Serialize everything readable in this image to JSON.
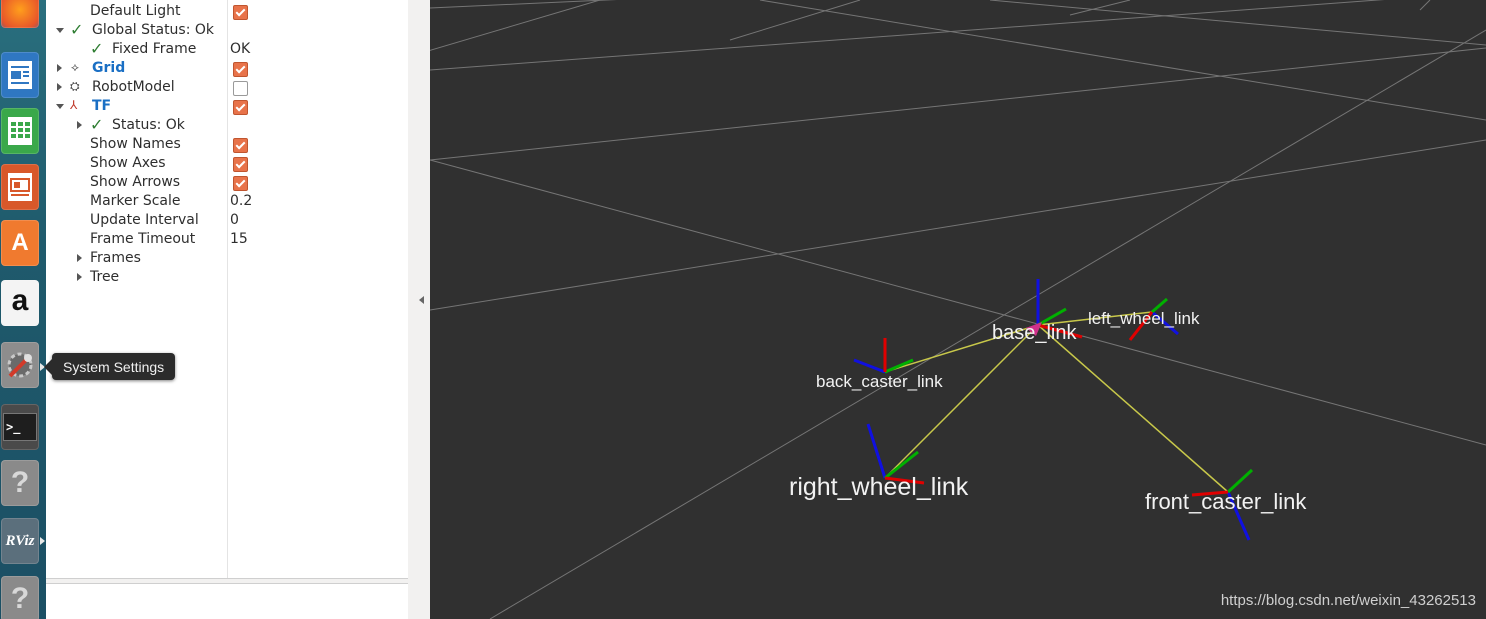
{
  "launcher": {
    "items": [
      {
        "name": "firefox-icon",
        "glyph": ""
      },
      {
        "name": "writer-icon",
        "glyph": ""
      },
      {
        "name": "calc-icon",
        "glyph": ""
      },
      {
        "name": "impress-icon",
        "glyph": ""
      },
      {
        "name": "software-center-icon",
        "glyph": "A"
      },
      {
        "name": "amazon-icon",
        "glyph": "a"
      },
      {
        "name": "system-settings-icon",
        "glyph": ""
      },
      {
        "name": "terminal-icon",
        "glyph": ">_"
      },
      {
        "name": "unknown-app-icon",
        "glyph": "?"
      },
      {
        "name": "rviz-icon",
        "glyph": "RViz"
      },
      {
        "name": "unknown-app-icon-2",
        "glyph": "?"
      }
    ],
    "tooltip": "System Settings"
  },
  "displays": {
    "rows": [
      {
        "label": "Default Light",
        "value": "",
        "checkbox": "on"
      },
      {
        "label": "Global Status: Ok",
        "value": "",
        "checkbox": ""
      },
      {
        "label": "Fixed Frame",
        "value": "OK",
        "checkbox": ""
      },
      {
        "label": "Grid",
        "value": "",
        "checkbox": "on"
      },
      {
        "label": "RobotModel",
        "value": "",
        "checkbox": "off"
      },
      {
        "label": "TF",
        "value": "",
        "checkbox": "on"
      },
      {
        "label": "Status: Ok",
        "value": "",
        "checkbox": ""
      },
      {
        "label": "Show Names",
        "value": "",
        "checkbox": "on"
      },
      {
        "label": "Show Axes",
        "value": "",
        "checkbox": "on"
      },
      {
        "label": "Show Arrows",
        "value": "",
        "checkbox": "on"
      },
      {
        "label": "Marker Scale",
        "value": "0.2",
        "checkbox": ""
      },
      {
        "label": "Update Interval",
        "value": "0",
        "checkbox": ""
      },
      {
        "label": "Frame Timeout",
        "value": "15",
        "checkbox": ""
      },
      {
        "label": "Frames",
        "value": "",
        "checkbox": ""
      },
      {
        "label": "Tree",
        "value": "",
        "checkbox": ""
      }
    ]
  },
  "view": {
    "frames": [
      {
        "name": "base_link"
      },
      {
        "name": "left_wheel_link"
      },
      {
        "name": "back_caster_link"
      },
      {
        "name": "right_wheel_link"
      },
      {
        "name": "front_caster_link"
      }
    ],
    "watermark": "https://blog.csdn.net/weixin_43262513"
  },
  "colors": {
    "accent_checkbox": "#e8734a",
    "view_background": "#303030",
    "grid_line": "#8c8c8c",
    "tf_link_line": "#c8c84a",
    "axis_x": "#e00000",
    "axis_y": "#00b000",
    "axis_z": "#1010e0",
    "status_ok": "#2e7d32",
    "blue_label": "#1a6fc4"
  }
}
